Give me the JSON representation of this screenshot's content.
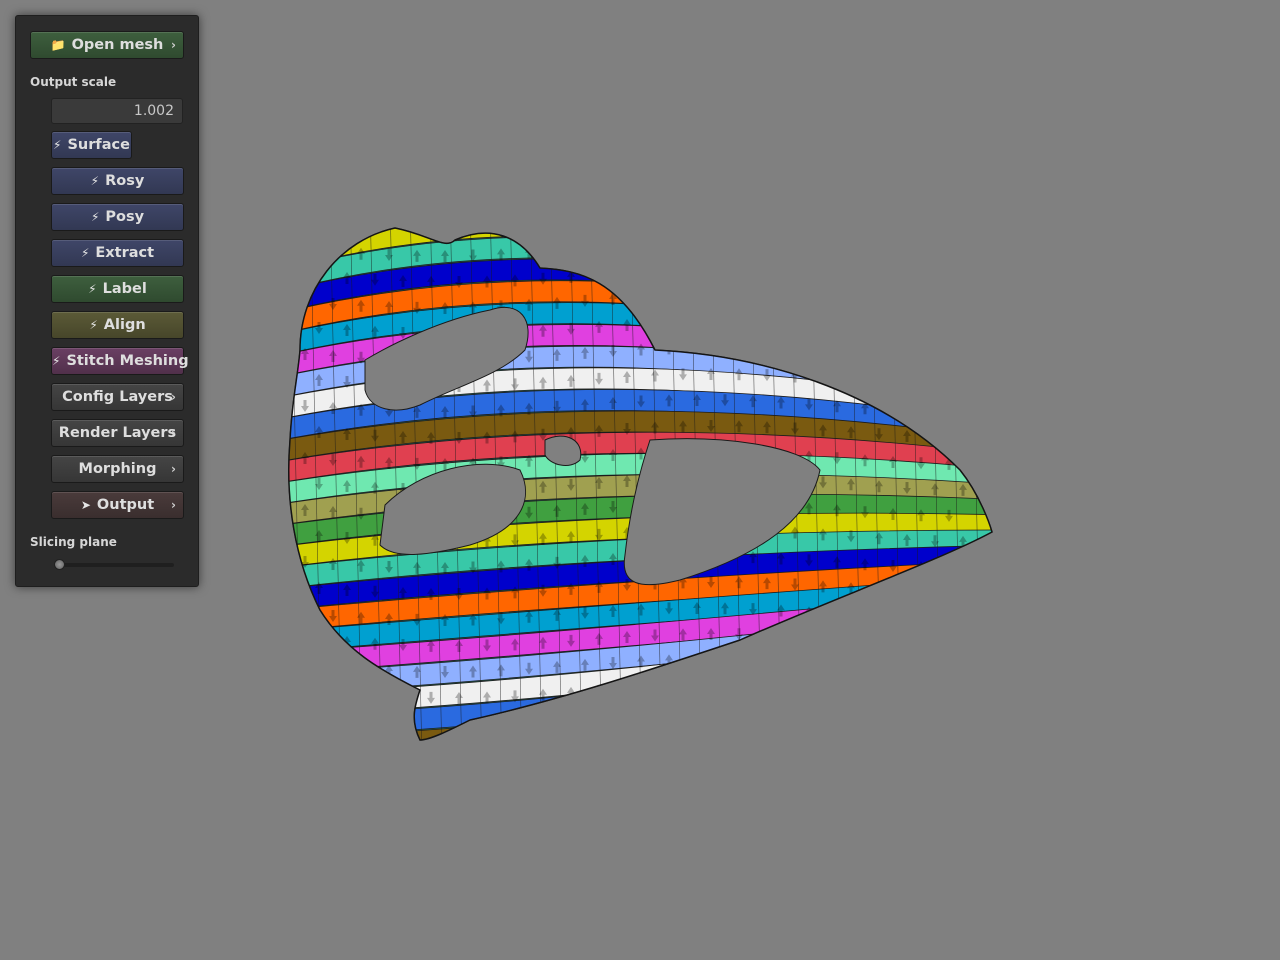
{
  "panel": {
    "open_mesh_label": "Open mesh",
    "output_scale_label": "Output scale",
    "output_scale_value": "1.002",
    "buttons": [
      {
        "label": "Surface"
      },
      {
        "label": "Rosy"
      },
      {
        "label": "Posy"
      },
      {
        "label": "Extract"
      },
      {
        "label": "Label"
      },
      {
        "label": "Align"
      },
      {
        "label": "Stitch Meshing"
      },
      {
        "label": "Config Layers"
      },
      {
        "label": "Render Layers"
      },
      {
        "label": "Morphing"
      },
      {
        "label": "Output"
      }
    ],
    "slicing_plane_label": "Slicing plane",
    "slicing_plane_value": 0
  },
  "icons": {
    "open_mesh": "folder-icon",
    "actions": "lightning-icon",
    "output": "rocket-icon",
    "submenu": "chevron-right-icon"
  },
  "colors": {
    "background": "#808080",
    "panel": "#2b2b2b",
    "button_green": "#3e5f3e",
    "button_blue": "#3f4668",
    "button_olive": "#5b5a37",
    "button_purple": "#6a3f63",
    "button_gray": "#454545",
    "mesh_stripes": [
      "#d4d400",
      "#38c8a8",
      "#0000cc",
      "#ff6600",
      "#00a0d0",
      "#e040e0",
      "#8fb0ff",
      "#f0f0f0",
      "#2a6ae0",
      "#7a5a10",
      "#e04050",
      "#6fe8b0",
      "#a0a050",
      "#40a040"
    ]
  }
}
